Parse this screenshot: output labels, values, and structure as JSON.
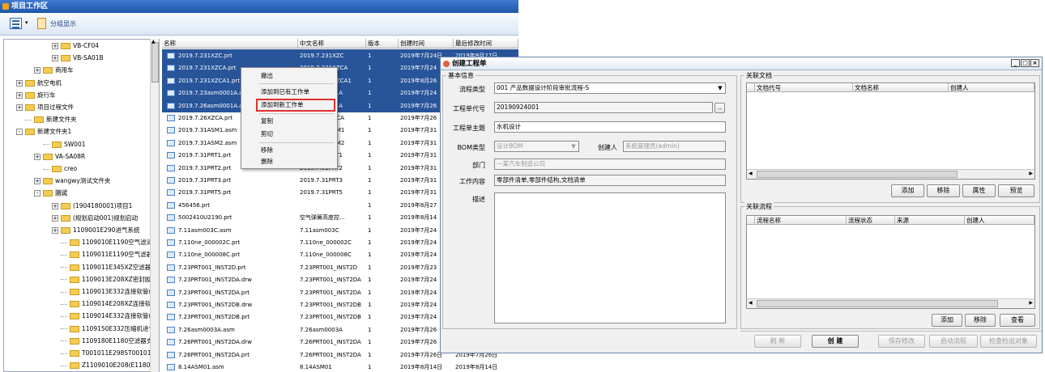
{
  "workspace": {
    "title": "项目工作区",
    "toolbar": {
      "group_label": "分组显示"
    }
  },
  "tree": {
    "items": [
      {
        "label": "VB-CF04",
        "indent": 5,
        "exp": "+"
      },
      {
        "label": "VB-SA01B",
        "indent": 5,
        "exp": "+"
      },
      {
        "label": "商用车",
        "indent": 3,
        "exp": "+"
      },
      {
        "label": "航空电机",
        "indent": 1,
        "exp": "+"
      },
      {
        "label": "旋行车",
        "indent": 1,
        "exp": "+"
      },
      {
        "label": "项目过程文件",
        "indent": 1,
        "exp": "+"
      },
      {
        "label": "新建文件夹",
        "indent": 2,
        "exp": ""
      },
      {
        "label": "新建文件夹1",
        "indent": 1,
        "exp": "-"
      },
      {
        "label": "SW001",
        "indent": 4,
        "exp": ""
      },
      {
        "label": "VA-SA08R",
        "indent": 3,
        "exp": "+"
      },
      {
        "label": "creo",
        "indent": 4,
        "exp": ""
      },
      {
        "label": "wangwy测试文件夹",
        "indent": 3,
        "exp": "+"
      },
      {
        "label": "测试",
        "indent": 3,
        "exp": "-",
        "selected": true
      },
      {
        "label": "(1904180001)项目1",
        "indent": 5,
        "exp": "+"
      },
      {
        "label": "(规划启动001)规划启动",
        "indent": 5,
        "exp": "+"
      },
      {
        "label": "1109001E290进气系统",
        "indent": 5,
        "exp": "+"
      },
      {
        "label": "1109010E1190空气滤清",
        "indent": 6,
        "exp": ""
      },
      {
        "label": "1109011E1190空气滤器进",
        "indent": 6,
        "exp": ""
      },
      {
        "label": "1109011E345XZ空滤器出",
        "indent": 6,
        "exp": ""
      },
      {
        "label": "1109013E208XZ密封胶套",
        "indent": 6,
        "exp": ""
      },
      {
        "label": "1109013E332连接软管(",
        "indent": 6,
        "exp": ""
      },
      {
        "label": "1109014E208XZ连接软管",
        "indent": 6,
        "exp": ""
      },
      {
        "label": "1109014E332连接软管(",
        "indent": 6,
        "exp": ""
      },
      {
        "label": "1109150E332压缩机进气",
        "indent": 6,
        "exp": ""
      },
      {
        "label": "1109180E1180空滤器支",
        "indent": 6,
        "exp": ""
      },
      {
        "label": "T001011E298ST001011E",
        "indent": 6,
        "exp": ""
      },
      {
        "label": "Z1109010E208(E1180)空",
        "indent": 6,
        "exp": ""
      }
    ]
  },
  "filelist": {
    "columns": [
      "名称",
      "中文名称",
      "版本",
      "创建时间",
      "最后修改时间"
    ],
    "rows": [
      {
        "name": "2019.7.231XZC.prt",
        "cn": "2019.7.231XZC",
        "ver": "1",
        "created": "2019年7月24日",
        "modified": "2019年8月27日",
        "sel": true
      },
      {
        "name": "2019.7.231XZCA.prt",
        "cn": "2019.7.231XZCA",
        "ver": "1",
        "created": "2019年7月24",
        "modified": "",
        "sel": true
      },
      {
        "name": "2019.7.231XZCA1.prt",
        "cn": "2019.7.231XZCA1",
        "ver": "1",
        "created": "2019年8月26",
        "modified": "",
        "sel": true
      },
      {
        "name": "2019.7.23asm0001A.asm",
        "cn": "7.23asm0001A",
        "ver": "1",
        "created": "2019年7月24",
        "modified": "",
        "sel": true
      },
      {
        "name": "2019.7.26asm0001A.asm",
        "cn": "7.26asm0001A",
        "ver": "1",
        "created": "2019年7月26",
        "modified": "",
        "sel": true
      },
      {
        "name": "2019.7.26XZCA.prt",
        "cn": "2019.7.26XZCA",
        "ver": "1",
        "created": "2019年7月26",
        "modified": "",
        "sel": false
      },
      {
        "name": "2019.7.31ASM1.asm",
        "cn": "2019.7.31ASM1",
        "ver": "1",
        "created": "2019年7月31",
        "modified": "",
        "sel": false
      },
      {
        "name": "2019.7.31ASM2.asm",
        "cn": "2019.7.31ASM2",
        "ver": "1",
        "created": "2019年7月31",
        "modified": "",
        "sel": false
      },
      {
        "name": "2019.7.31PRT1.prt",
        "cn": "2019.7.31PRT1",
        "ver": "1",
        "created": "2019年7月31",
        "modified": "",
        "sel": false
      },
      {
        "name": "2019.7.31PRT2.prt",
        "cn": "2019.7.31PRT2",
        "ver": "1",
        "created": "2019年7月31",
        "modified": "",
        "sel": false
      },
      {
        "name": "2019.7.31PRT3.prt",
        "cn": "2019.7.31PRT3",
        "ver": "1",
        "created": "2019年7月31",
        "modified": "",
        "sel": false
      },
      {
        "name": "2019.7.31PRT5.prt",
        "cn": "2019.7.31PRT5",
        "ver": "1",
        "created": "2019年7月31",
        "modified": "",
        "sel": false
      },
      {
        "name": "456456.prt",
        "cn": "",
        "ver": "1",
        "created": "2019年8月27",
        "modified": "",
        "sel": false
      },
      {
        "name": "5002410U2190.prt",
        "cn": "空气弹簧高度控...",
        "ver": "1",
        "created": "2019年8月14",
        "modified": "",
        "sel": false
      },
      {
        "name": "7.11asm003C.asm",
        "cn": "7.11asm003C",
        "ver": "1",
        "created": "2019年7月24",
        "modified": "",
        "sel": false
      },
      {
        "name": "7.110ne_000002C.prt",
        "cn": "7.110ne_000002C",
        "ver": "1",
        "created": "2019年7月24",
        "modified": "",
        "sel": false
      },
      {
        "name": "7.110ne_000008C.prt",
        "cn": "7.110ne_000008C",
        "ver": "1",
        "created": "2019年7月24",
        "modified": "",
        "sel": false
      },
      {
        "name": "7.23PRT001_INST2D.prt",
        "cn": "7.23PRT001_INST2D",
        "ver": "1",
        "created": "2019年7月23",
        "modified": "",
        "sel": false
      },
      {
        "name": "7.23PRT001_INST2DA.drw",
        "cn": "7.23PRT001_INST2DA",
        "ver": "1",
        "created": "2019年7月24",
        "modified": "",
        "sel": false
      },
      {
        "name": "7.23PRT001_INST2DA.prt",
        "cn": "7.23PRT001_INST2DA",
        "ver": "1",
        "created": "2019年7月24",
        "modified": "",
        "sel": false
      },
      {
        "name": "7.23PRT001_INST2DB.drw",
        "cn": "7.23PRT001_INST2DB",
        "ver": "1",
        "created": "2019年7月24",
        "modified": "",
        "sel": false
      },
      {
        "name": "7.23PRT001_INST2DB.prt",
        "cn": "7.23PRT001_INST2DB",
        "ver": "1",
        "created": "2019年7月24",
        "modified": "",
        "sel": false
      },
      {
        "name": "7.26asm0003A.asm",
        "cn": "7.26asm0003A",
        "ver": "1",
        "created": "2019年7月26",
        "modified": "",
        "sel": false
      },
      {
        "name": "7.26PRT001_INST2DA.drw",
        "cn": "7.26PRT001_INST2DA",
        "ver": "1",
        "created": "2019年7月26",
        "modified": "",
        "sel": false
      },
      {
        "name": "7.26PRT001_INST2DA.prt",
        "cn": "7.26PRT001_INST2DA",
        "ver": "1",
        "created": "2019年7月26日",
        "modified": "2019年7月26日",
        "sel": false
      },
      {
        "name": "8.14ASM01.asm",
        "cn": "8.14ASM01",
        "ver": "1",
        "created": "2019年8月14日",
        "modified": "2019年8月14日",
        "sel": false
      }
    ]
  },
  "context_menu": {
    "items": [
      "撤出",
      "添加到已有工作单",
      "添加到新工作单",
      "复制",
      "剪切",
      "移除",
      "删除"
    ]
  },
  "dialog": {
    "title": "创建工程单",
    "basic_group": "基本信息",
    "process_type_label": "流程类型",
    "process_type_value": "001 产品数据设计阶段审批流程-S",
    "order_code_label": "工程单代号",
    "order_code_value": "20190924001",
    "order_subject_label": "工程单主题",
    "order_subject_value": "水机设计",
    "bom_type_label": "BOM类型",
    "bom_type_value": "设计BOM",
    "creator_label": "创建人",
    "creator_value": "系统管理员(admin)",
    "dept_label": "部门",
    "dept_value": "一某汽车制造公司",
    "work_label": "工作内容",
    "work_value": "零部件清单,零部件结构,文档清单",
    "desc_label": "描述",
    "docs_group": "关联文档",
    "docs_columns": [
      "文档代号",
      "文档名称",
      "创建人"
    ],
    "flow_group": "关联流程",
    "flow_columns": [
      "流程名称",
      "流程状态",
      "来源",
      "创建人"
    ],
    "buttons": {
      "add": "添加",
      "remove": "移除",
      "attr": "属性",
      "preview": "预览",
      "add2": "添加",
      "remove2": "移除",
      "view": "查看",
      "refresh": "刷 新",
      "create": "创 建",
      "save": "保存修改",
      "start": "启动流程",
      "checkout": "检查检出对象"
    }
  }
}
